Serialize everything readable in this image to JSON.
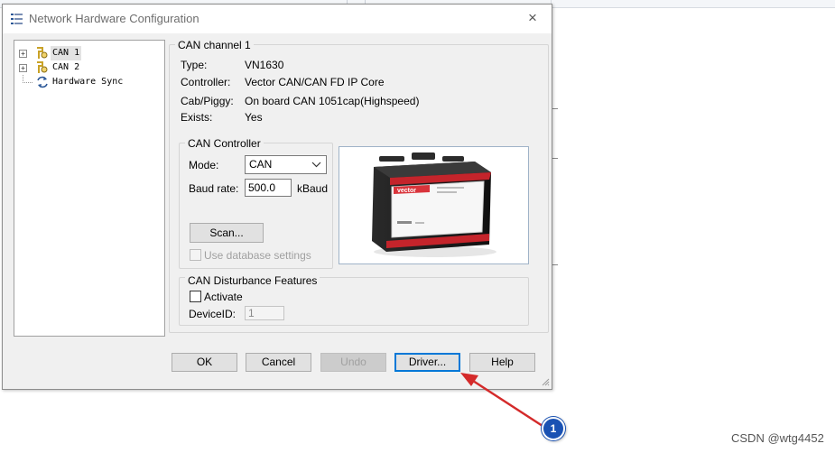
{
  "dialog": {
    "title": "Network Hardware Configuration",
    "close_label": "×"
  },
  "tree": {
    "items": [
      {
        "label": "CAN 1",
        "expand": "+",
        "selected": true
      },
      {
        "label": "CAN 2",
        "expand": "+"
      },
      {
        "label": "Hardware Sync"
      }
    ]
  },
  "channel": {
    "group_title": "CAN channel 1",
    "props": [
      {
        "label": "Type:",
        "value": "VN1630"
      },
      {
        "label": "Controller:",
        "value": "Vector CAN/CAN FD IP Core"
      },
      {
        "label": "Cab/Piggy:",
        "value": "On board CAN 1051cap(Highspeed)"
      },
      {
        "label": "Exists:",
        "value": "Yes"
      }
    ]
  },
  "can_controller": {
    "group_title": "CAN Controller",
    "mode_label": "Mode:",
    "mode_value": "CAN",
    "baud_label": "Baud rate:",
    "baud_value": "500.0",
    "baud_unit": "kBaud",
    "scan_label": "Scan...",
    "use_db_label": "Use database settings"
  },
  "disturbance": {
    "group_title": "CAN Disturbance Features",
    "activate_label": "Activate",
    "device_id_label": "DeviceID:",
    "device_id_value": "1"
  },
  "device_image": {
    "brand": "vector"
  },
  "buttons": {
    "ok": "OK",
    "cancel": "Cancel",
    "undo": "Undo",
    "driver": "Driver...",
    "help": "Help"
  },
  "annotation": {
    "badge": "1",
    "arrow_color": "#d42a2a"
  },
  "watermark": "CSDN @wtg4452",
  "colors": {
    "focus": "#0078d7",
    "badge": "#1a52b3"
  }
}
